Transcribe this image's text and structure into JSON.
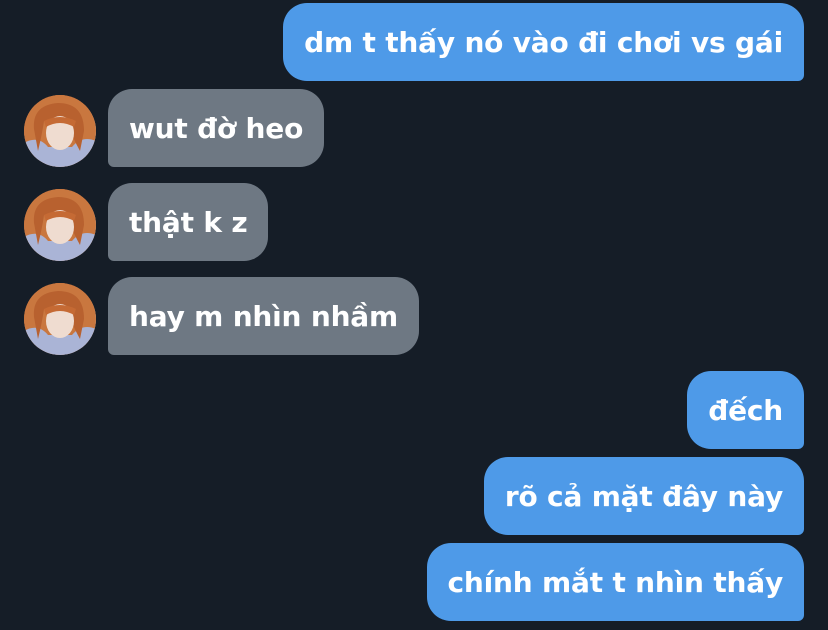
{
  "messages": [
    {
      "direction": "outgoing",
      "text": "dm t thấy nó vào đi chơi vs gái"
    },
    {
      "direction": "incoming",
      "text": "wut đờ heo",
      "avatar": "contact-avatar-photo"
    },
    {
      "direction": "incoming",
      "text": "thật k z",
      "avatar": "contact-avatar-photo"
    },
    {
      "direction": "incoming",
      "text": "hay m nhìn nhầm",
      "avatar": "contact-avatar-photo"
    },
    {
      "direction": "outgoing",
      "text": "đếch"
    },
    {
      "direction": "outgoing",
      "text": "rõ cả mặt đây này"
    },
    {
      "direction": "outgoing",
      "text": "chính mắt t nhìn thấy"
    }
  ],
  "colors": {
    "background": "#151d27",
    "outgoing_bubble": "#4e9ae8",
    "incoming_bubble": "#6e7883",
    "text": "#ffffff"
  }
}
